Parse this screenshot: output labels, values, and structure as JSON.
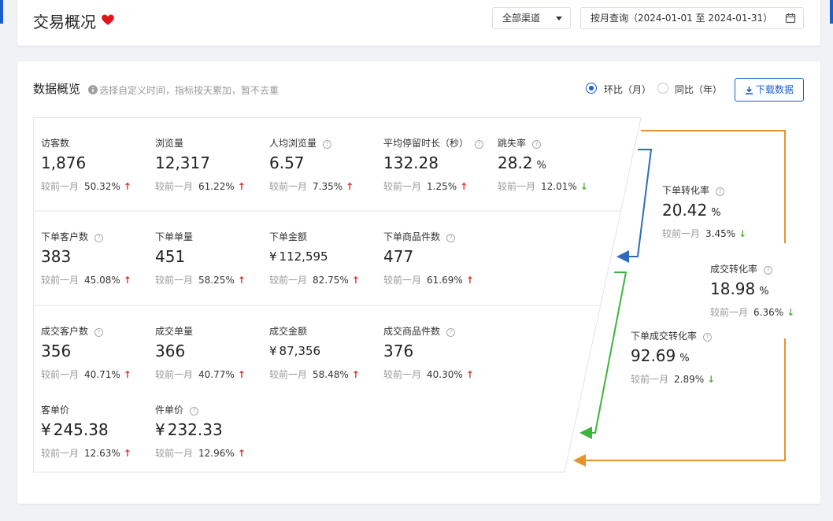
{
  "header": {
    "title": "交易概况",
    "channel_select": "全部渠道",
    "date_range": "按月查询（2024-01-01 至 2024-01-31）"
  },
  "overview": {
    "title": "数据概览",
    "hint": "选择自定义时间，指标按天累加，暂不去重",
    "radio_mom": "环比（月）",
    "radio_yoy": "同比（年）",
    "download": "下载数据",
    "compare_label": "较前一月",
    "help_glyph": "?",
    "up_arrow": "↑",
    "down_arrow": "↓",
    "currency": "¥",
    "percent": "%"
  },
  "metrics": {
    "visitors": {
      "label": "访客数",
      "value": "1,876",
      "pct": "50.32%",
      "trend": "up"
    },
    "pageviews": {
      "label": "浏览量",
      "value": "12,317",
      "pct": "61.22%",
      "trend": "up"
    },
    "avg_pageviews": {
      "label": "人均浏览量",
      "value": "6.57",
      "pct": "7.35%",
      "trend": "up"
    },
    "avg_stay": {
      "label": "平均停留时长（秒）",
      "value": "132.28",
      "pct": "1.25%",
      "trend": "up"
    },
    "bounce_rate": {
      "label": "跳失率",
      "value": "28.2",
      "pct": "12.01%",
      "trend": "down"
    },
    "order_customers": {
      "label": "下单客户数",
      "value": "383",
      "pct": "45.08%",
      "trend": "up"
    },
    "order_count": {
      "label": "下单单量",
      "value": "451",
      "pct": "58.25%",
      "trend": "up"
    },
    "order_amount": {
      "label": "下单金额",
      "value": "112,595",
      "pct": "82.75%",
      "trend": "up"
    },
    "order_items": {
      "label": "下单商品件数",
      "value": "477",
      "pct": "61.69%",
      "trend": "up"
    },
    "deal_customers": {
      "label": "成交客户数",
      "value": "356",
      "pct": "40.71%",
      "trend": "up"
    },
    "deal_count": {
      "label": "成交单量",
      "value": "366",
      "pct": "40.77%",
      "trend": "up"
    },
    "deal_amount": {
      "label": "成交金额",
      "value": "87,356",
      "pct": "58.48%",
      "trend": "up"
    },
    "deal_items": {
      "label": "成交商品件数",
      "value": "376",
      "pct": "40.30%",
      "trend": "up"
    },
    "avg_order_price": {
      "label": "客单价",
      "value": "245.38",
      "pct": "12.63%",
      "trend": "up"
    },
    "avg_item_price": {
      "label": "件单价",
      "value": "232.33",
      "pct": "12.96%",
      "trend": "up"
    }
  },
  "conversions": {
    "order_rate": {
      "label": "下单转化率",
      "value": "20.42",
      "pct": "3.45%",
      "trend": "down"
    },
    "deal_rate": {
      "label": "成交转化率",
      "value": "18.98",
      "pct": "6.36%",
      "trend": "down"
    },
    "order_deal_rate": {
      "label": "下单成交转化率",
      "value": "92.69",
      "pct": "2.89%",
      "trend": "down"
    }
  },
  "colors": {
    "accent": "#1a5fd0",
    "up": "#e0322b",
    "down": "#52b13d",
    "flow_blue": "#2f6bbd",
    "flow_green": "#3cb53c",
    "flow_orange": "#e8912d",
    "border": "#dcdfe6"
  }
}
